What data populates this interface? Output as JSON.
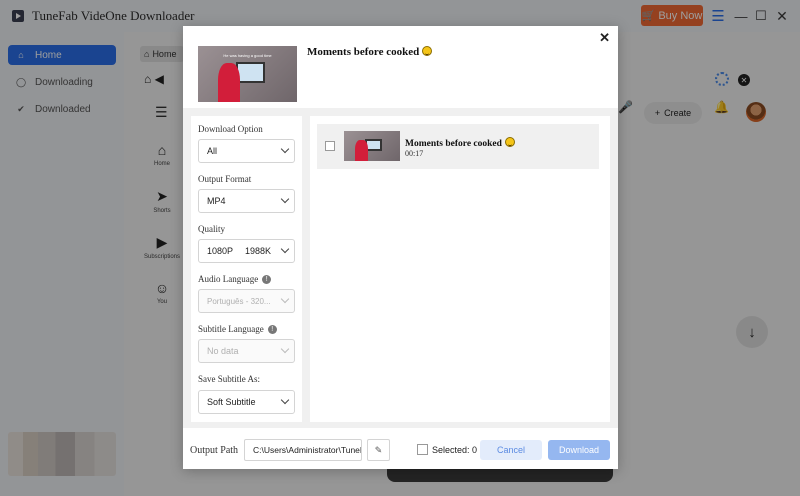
{
  "app": {
    "title": "TuneFab VideOne Downloader",
    "buy_label": "Buy Now"
  },
  "sidebar": {
    "items": [
      {
        "label": "Home",
        "icon": "home-icon"
      },
      {
        "label": "Downloading",
        "icon": "download-circle-icon"
      },
      {
        "label": "Downloaded",
        "icon": "check-circle-icon"
      }
    ]
  },
  "browser": {
    "tab_label": "Home",
    "rail": [
      {
        "label": "Home",
        "icon": "home-icon"
      },
      {
        "label": "Shorts",
        "icon": "shorts-icon"
      },
      {
        "label": "Subscriptions",
        "icon": "subscriptions-icon"
      },
      {
        "label": "You",
        "icon": "user-icon"
      }
    ],
    "create_label": "Create"
  },
  "dialog": {
    "header_title": "Moments before cooked",
    "thumb_caption": "He was having a good time",
    "options": {
      "download_option": {
        "label": "Download Option",
        "value": "All"
      },
      "output_format": {
        "label": "Output Format",
        "value": "MP4"
      },
      "quality": {
        "label": "Quality",
        "value": "1080P",
        "size": "1988K"
      },
      "audio_language": {
        "label": "Audio Language",
        "value": "Português - 320..."
      },
      "subtitle_language": {
        "label": "Subtitle Language",
        "value": "No data"
      },
      "save_subtitle": {
        "label": "Save Subtitle As:",
        "value": "Soft Subtitle"
      }
    },
    "video": {
      "title": "Moments before cooked",
      "duration": "00:17"
    },
    "footer": {
      "output_path_label": "Output Path",
      "output_path_value": "C:\\Users\\Administrator\\TuneFab",
      "selected_label": "Selected: 0",
      "cancel_label": "Cancel",
      "download_label": "Download"
    }
  },
  "colors": {
    "accent": "#2b6fe8",
    "buy": "#f06a35",
    "download_btn": "#95b7f0",
    "cancel_btn": "#e3ecfb"
  }
}
